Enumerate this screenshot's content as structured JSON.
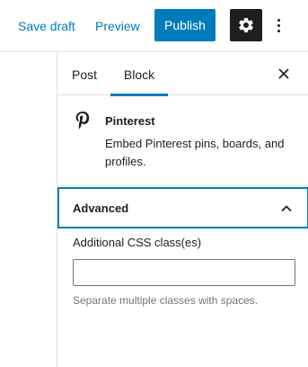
{
  "header": {
    "save_draft_label": "Save draft",
    "preview_label": "Preview",
    "publish_label": "Publish",
    "settings_icon": "gear-icon",
    "more_icon": "more-vertical-icon"
  },
  "sidebar": {
    "tabs": [
      {
        "label": "Post",
        "active": false
      },
      {
        "label": "Block",
        "active": true
      }
    ],
    "close_icon": "close-icon",
    "block": {
      "icon": "pinterest-icon",
      "name": "Pinterest",
      "description": "Embed Pinterest pins, boards, and profiles."
    },
    "advanced": {
      "label": "Advanced",
      "expanded": true,
      "css_class_label": "Additional CSS class(es)",
      "css_class_value": "",
      "help_text": "Separate multiple classes with spaces."
    }
  },
  "colors": {
    "accent": "#007cba",
    "text": "#1e1e1e",
    "muted": "#757575",
    "border": "#e0e0e0"
  }
}
